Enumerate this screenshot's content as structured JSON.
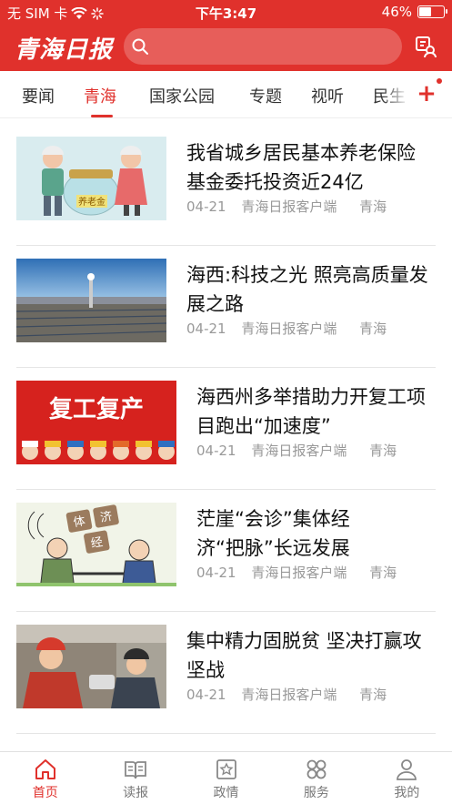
{
  "status_bar": {
    "carrier": "无 SIM 卡",
    "time": "下午3:47",
    "battery": "46%",
    "battery_level": 0.46
  },
  "header": {
    "logo": "青海日报",
    "search_placeholder": ""
  },
  "tabs": [
    {
      "label": "要闻",
      "active": false
    },
    {
      "label": "青海",
      "active": true
    },
    {
      "label": "国家公园",
      "active": false
    },
    {
      "label": "专题",
      "active": false
    },
    {
      "label": "视听",
      "active": false
    },
    {
      "label": "民生",
      "active": false
    }
  ],
  "add_channel": "+",
  "news": [
    {
      "title": "我省城乡居民基本养老保险基金委托投资近24亿",
      "date": "04-21",
      "source": "青海日报客户端",
      "category": "青海",
      "thumb_text": "养老金"
    },
    {
      "title": "海西:科技之光 照亮高质量发展之路",
      "date": "04-21",
      "source": "青海日报客户端",
      "category": "青海"
    },
    {
      "title": "海西州多举措助力开复工项目跑出“加速度”",
      "date": "04-21",
      "source": "青海日报客户端",
      "category": "青海",
      "thumb_text": "复工复产"
    },
    {
      "title": "茫崖“会诊”集体经济“把脉”长远发展",
      "date": "04-21",
      "source": "青海日报客户端",
      "category": "青海",
      "thumb_text": [
        "体",
        "济",
        "经"
      ]
    },
    {
      "title": "集中精力固脱贫 坚决打赢攻坚战",
      "date": "04-21",
      "source": "青海日报客户端",
      "category": "青海"
    }
  ],
  "bottom_nav": [
    {
      "label": "首页",
      "icon": "home-icon",
      "active": true
    },
    {
      "label": "读报",
      "icon": "book-icon",
      "active": false
    },
    {
      "label": "政情",
      "icon": "badge-icon",
      "active": false
    },
    {
      "label": "服务",
      "icon": "grid-icon",
      "active": false
    },
    {
      "label": "我的",
      "icon": "user-icon",
      "active": false
    }
  ],
  "colors": {
    "brand": "#e0312c",
    "meta": "#999999"
  }
}
